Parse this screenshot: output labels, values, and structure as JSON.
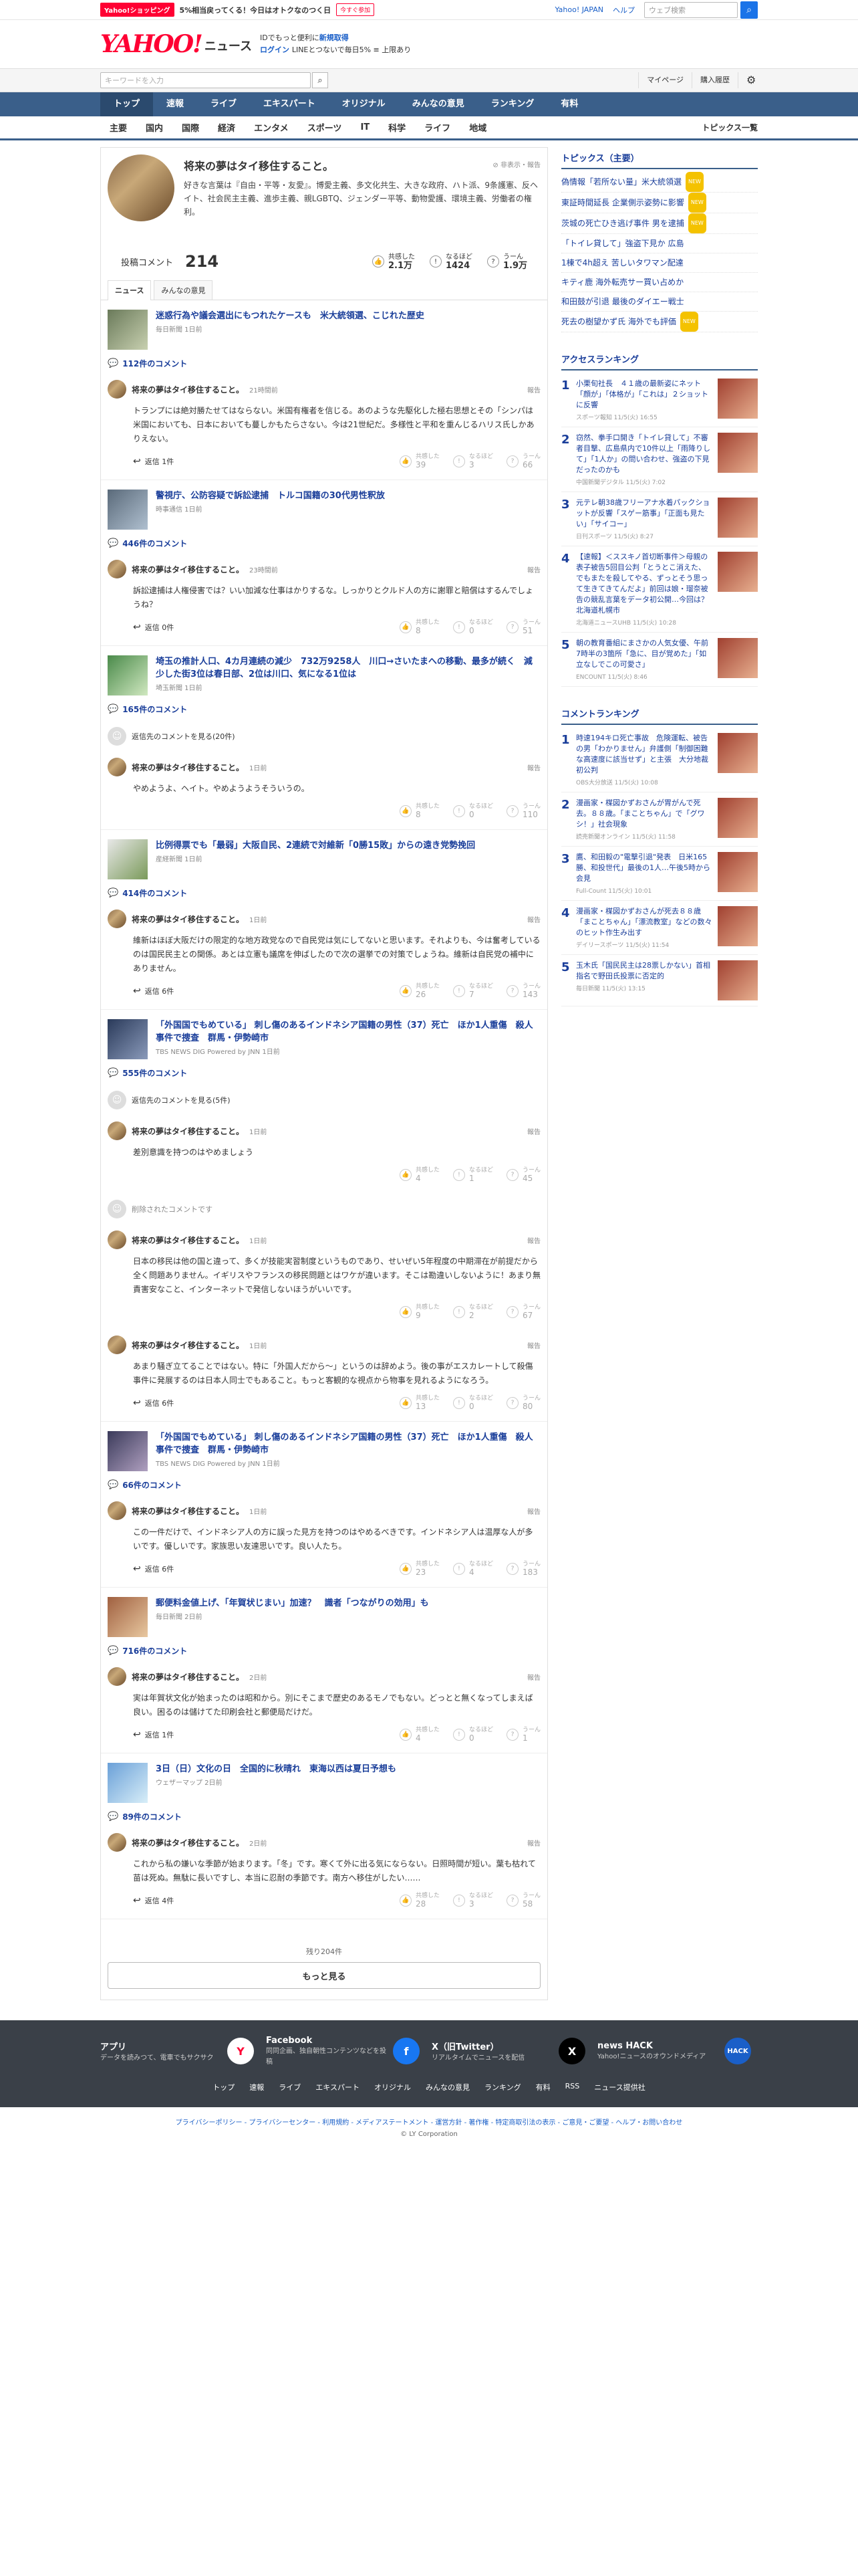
{
  "promo": {
    "badge": "Yahoo!ショッピング",
    "text": "5%相当戻ってくる！今日はオトクなのつく日",
    "cta": "今すぐ参加",
    "links": [
      "Yahoo! JAPAN",
      "ヘルプ"
    ],
    "search_placeholder": "ウェブ検索"
  },
  "header": {
    "logo": "YAHOO!",
    "logo_sub": "JAPAN",
    "section": "ニュース",
    "login_line1": "IDでもっと便利に",
    "login_line1_link": "新規取得",
    "login_line2_link": "ログイン",
    "login_line2": "LINEとつないで毎日5% ≡ 上限あり"
  },
  "search": {
    "placeholder": "キーワードを入力",
    "buttons": [
      "マイページ",
      "購入履歴"
    ]
  },
  "nav": [
    "トップ",
    "速報",
    "ライブ",
    "エキスパート",
    "オリジナル",
    "みんなの意見",
    "ランキング",
    "有料"
  ],
  "categories": [
    "主要",
    "国内",
    "国際",
    "経済",
    "エンタメ",
    "スポーツ",
    "IT",
    "科学",
    "ライフ",
    "地域"
  ],
  "categories_right": "トピックス一覧",
  "user": {
    "name": "将来の夢はタイ移住すること。",
    "report": "非表示・報告",
    "bio": "好きな言葉は『自由・平等・友愛』。博愛主義、多文化共生、大きな政府、ハト派、9条護憲、反ヘイト、社会民主主義、進歩主義、親LGBTQ、ジェンダー平等、動物愛護、環境主義、労働者の権利。"
  },
  "stats": {
    "label": "投稿コメント",
    "count": "214",
    "reactions": [
      {
        "label": "共感した",
        "value": "2.1万",
        "icon": "👍"
      },
      {
        "label": "なるほど",
        "value": "1424",
        "icon": "!"
      },
      {
        "label": "うーん",
        "value": "1.9万",
        "icon": "?"
      }
    ]
  },
  "tabs": [
    "ニュース",
    "みんなの意見"
  ],
  "articles": [
    {
      "title": "迷惑行為や議会選出にもつれたケースも　米大統領選、こじれた歴史",
      "source": "毎日新聞 1日前",
      "count": "112件のコメント",
      "comments": [
        {
          "time": "21時間前",
          "text": "トランプには絶対勝たせてはならない。米国有権者を信じる。あのような先駆化した極右思想とその「シンパは米国においても、日本においても蔓しかもたらさない。今は21世紀だ。多様性と平和を重んじるハリス氏しかありえない。",
          "reply": "返信 1件",
          "votes": [
            "39",
            "3",
            "66"
          ]
        }
      ]
    },
    {
      "title": "警視庁、公防容疑で訴訟逮捕　トルコ国籍の30代男性釈放",
      "source": "時事通信 1日前",
      "count": "446件のコメント",
      "comments": [
        {
          "time": "23時間前",
          "text": "訴訟逮捕は人権侵害では？いい加減な仕事はかりするな。しっかりとクルド人の方に謝罪と賠償はするんでしょうね？",
          "reply": "返信 0件",
          "votes": [
            "8",
            "0",
            "51"
          ]
        }
      ]
    },
    {
      "title": "埼玉の推計人口、4カ月連続の減少　732万9258人　川口→さいたまへの移動、最多が続く　減少した街3位は春日部、2位は川口、気になる1位は",
      "source": "埼玉新聞 1日前",
      "count": "165件のコメント",
      "others": "返信先のコメントを見る(20件)",
      "comments": [
        {
          "time": "1日前",
          "text": "やめようよ、ヘイト。やめようようそういうの。",
          "reply": "",
          "votes": [
            "8",
            "0",
            "110"
          ]
        }
      ]
    },
    {
      "title": "比例得票でも「最弱」大阪自民、2連続で対維新「0勝15敗」からの遠き党勢挽回",
      "source": "産経新聞 1日前",
      "count": "414件のコメント",
      "comments": [
        {
          "time": "1日前",
          "text": "維新はほぼ大阪だけの限定的な地方政党なので自民党は気にしてないと思います。それよりも、今は奮考しているのは国民民主との関係。あとは立憲も議席を伸ばしたので次の選挙での対策でしょうね。維新は自民党の補中にありません。",
          "reply": "返信 6件",
          "votes": [
            "26",
            "7",
            "143"
          ]
        }
      ]
    },
    {
      "title": "「外国国でもめている」 刺し傷のあるインドネシア国籍の男性（37）死亡　ほか1人重傷　殺人事件で捜査　群馬・伊勢崎市",
      "source": "TBS NEWS DIG Powered by JNN 1日前",
      "count": "555件のコメント",
      "others": "返信先のコメントを見る(5件)",
      "comments": [
        {
          "time": "1日前",
          "text": "差別意識を持つのはやめましょう",
          "reply": "",
          "votes": [
            "4",
            "1",
            "45"
          ]
        }
      ],
      "deleted": "削除されたコメントです",
      "comments2": [
        {
          "time": "1日前",
          "text": "日本の移民は他の国と違って、多くが技能実習制度というものであり、せいぜい5年程度の中期滞在が前提だから全く問題ありません。イギリスやフランスの移民問題とはワケが違います。そこは勘違いしないように！あまり無責害安なこと、インターネットで発信しないほうがいいです。",
          "reply": "",
          "votes": [
            "9",
            "2",
            "67"
          ]
        },
        {
          "time": "1日前",
          "text": "あまり騒ぎ立てることではない。特に「外国人だから～」というのは辞めよう。後の事がエスカレートして殺傷事件に発展するのは日本人同士でもあること。もっと客観的な視点から物事を見れるようになろう。",
          "reply": "返信 6件",
          "votes": [
            "13",
            "0",
            "80"
          ]
        }
      ]
    },
    {
      "title": "「外国国でもめている」 刺し傷のあるインドネシア国籍の男性（37）死亡　ほか1人重傷　殺人事件で捜査　群馬・伊勢崎市",
      "source": "TBS NEWS DIG Powered by JNN 1日前",
      "count": "66件のコメント",
      "comments": [
        {
          "time": "1日前",
          "text": "この一件だけで、インドネシア人の方に誤った見方を持つのはやめるべきです。インドネシア人は温厚な人が多いです。優しいです。家族思い友達思いです。良い人たち。",
          "reply": "返信 6件",
          "votes": [
            "23",
            "4",
            "183"
          ]
        }
      ]
    },
    {
      "title": "郵便料金値上げ、「年賀状じまい」加速？　識者「つながりの効用」も",
      "source": "毎日新聞 2日前",
      "count": "716件のコメント",
      "comments": [
        {
          "time": "2日前",
          "text": "実は年賀状文化が始まったのは昭和から。別にそこまで歴史のあるモノでもない。どっとと無くなってしまえば良い。困るのは儲けてた印刷会社と郵便局だけだ。",
          "reply": "返信 1件",
          "votes": [
            "4",
            "0",
            "1"
          ]
        }
      ]
    },
    {
      "title": "3日（日）文化の日　全国的に秋晴れ　東海以西は夏日予想も",
      "source": "ウェザーマップ 2日前",
      "count": "89件のコメント",
      "comments": [
        {
          "time": "2日前",
          "text": "これから私の嫌いな季節が始まります。「冬」です。寒くて外に出る気にならない。日照時間が短い。葉も枯れて苗は死ぬ。無駄に長いですし、本当に忍耐の季節です。南方へ移住がしたい……",
          "reply": "返信 4件",
          "votes": [
            "28",
            "3",
            "58"
          ]
        }
      ]
    }
  ],
  "vote_labels": [
    "共感した",
    "なるほど",
    "うーん"
  ],
  "remaining": "残り204件",
  "more": "もっと見る",
  "topics": {
    "title": "トピックス（主要）",
    "items": [
      {
        "t": "偽情報「若所ない量」米大統領選",
        "n": "NEW"
      },
      {
        "t": "東証時間延長 企業側示姿勢に影響",
        "n": "NEW"
      },
      {
        "t": "茨城の死亡ひき逃げ事件 男を逮捕",
        "n": "NEW"
      },
      {
        "t": "「トイレ貸して」強盗下見か 広島",
        "n": ""
      },
      {
        "t": "1棟で4h超え 苦しいタワマン配達",
        "n": ""
      },
      {
        "t": "キティ鹿 海外転売サー買い占めか",
        "n": ""
      },
      {
        "t": "和田鼓が引退 最後のダイエー戦士",
        "n": ""
      },
      {
        "t": "死去の樹望かず氏 海外でも評価",
        "n": "NEW"
      }
    ]
  },
  "access_rank": {
    "title": "アクセスランキング",
    "items": [
      {
        "t": "小栗旬社長　４１歳の最新姿にネット「顔が」「体格が」「これは」２ショットに反響",
        "s": "スポーツ報知 11/5(火) 16:55"
      },
      {
        "t": "窃然、拳手口開き「トイレ貸して」不審者目撃、広島県内で10件以上「雨降りして」「1人か」の問い合わせ、強盗の下見だったのかも",
        "s": "中国新聞デジタル 11/5(火) 7:02"
      },
      {
        "t": "元テレ朝38歳フリーアナ水着パックショットが反響「スゲー筋事」「正面も見たい」「サイコー」",
        "s": "日刊スポーツ 11/5(火) 8:27"
      },
      {
        "t": "【速報】＜ススキノ首切断事件＞母親の表子被告5回目公判「とうとこ消えた、でもまたを殺してやる、ずっとそう思って生きてきてんだよ」前回は娘・瑠奈被告の競乱言葉をデータ初公開…今回は？北海道札幌市",
        "s": "北海道ニュースUHB 11/5(火) 10:28"
      },
      {
        "t": "朝の教育番組にまさかの人気女優、午前7時半の3箇所「急に、目が覚めた」「如立なしでこの可愛さ」",
        "s": "ENCOUNT 11/5(火) 8:46"
      }
    ]
  },
  "comment_rank": {
    "title": "コメントランキング",
    "items": [
      {
        "t": "時速194キロ死亡事故　危険運転、被告の男「わかりません」弁護側「制御困難な高速度に該当せず」と主張　大分地裁初公判",
        "s": "OBS大分放送 11/5(火) 10:08"
      },
      {
        "t": "漫画家・楳図かずおさんが胃がんで死去。８８歳。「まことちゃん」で「グワシ！」社会現象",
        "s": "読売新聞オンライン 11/5(火) 11:58"
      },
      {
        "t": "鷹、和田毅の\"電撃引退\"発表　日米165勝、和投世代」最後の1人…午後5時から会見",
        "s": "Full-Count 11/5(火) 10:01"
      },
      {
        "t": "漫画家・楳図かずおさんが死去８８歳「まことちゃん」「漂流教室」などの数々のヒット作生み出す",
        "s": "デイリースポーツ 11/5(火) 11:54"
      },
      {
        "t": "玉木氏「国民民主は28票しかない」首相指名で野田氏投票に否定的",
        "s": "毎日新聞 11/5(火) 13:15"
      }
    ]
  },
  "footer": {
    "apps": [
      {
        "title": "アプリ",
        "desc": "データを読みつて、電車でもサクサク",
        "icon": "Y"
      },
      {
        "title": "Facebook",
        "desc": "同同企画、独自朝性コンテンツなどを投稿",
        "icon": "f"
      },
      {
        "title": "X（旧Twitter）",
        "desc": "リアルタイムでニュースを配信",
        "icon": "X"
      },
      {
        "title": "news HACK",
        "desc": "Yahoo!ニュースのオウンドメディア",
        "icon": "HACK"
      }
    ],
    "links": [
      "トップ",
      "速報",
      "ライブ",
      "エキスパート",
      "オリジナル",
      "みんなの意見",
      "ランキング",
      "有料",
      "RSS",
      "ニュース提供社"
    ],
    "legal": "プライバシーポリシー - プライバシーセンター - 利用規約 - メディアステートメント - 運営方針 - 著作権 - 特定商取引法の表示 - ご意見・ご要望 - ヘルプ・お問い合わせ",
    "copyright": "© LY Corporation"
  },
  "colors": {
    "accent": "#ff0033",
    "nav": "#3a5f8a",
    "link": "#1a3e9a"
  }
}
